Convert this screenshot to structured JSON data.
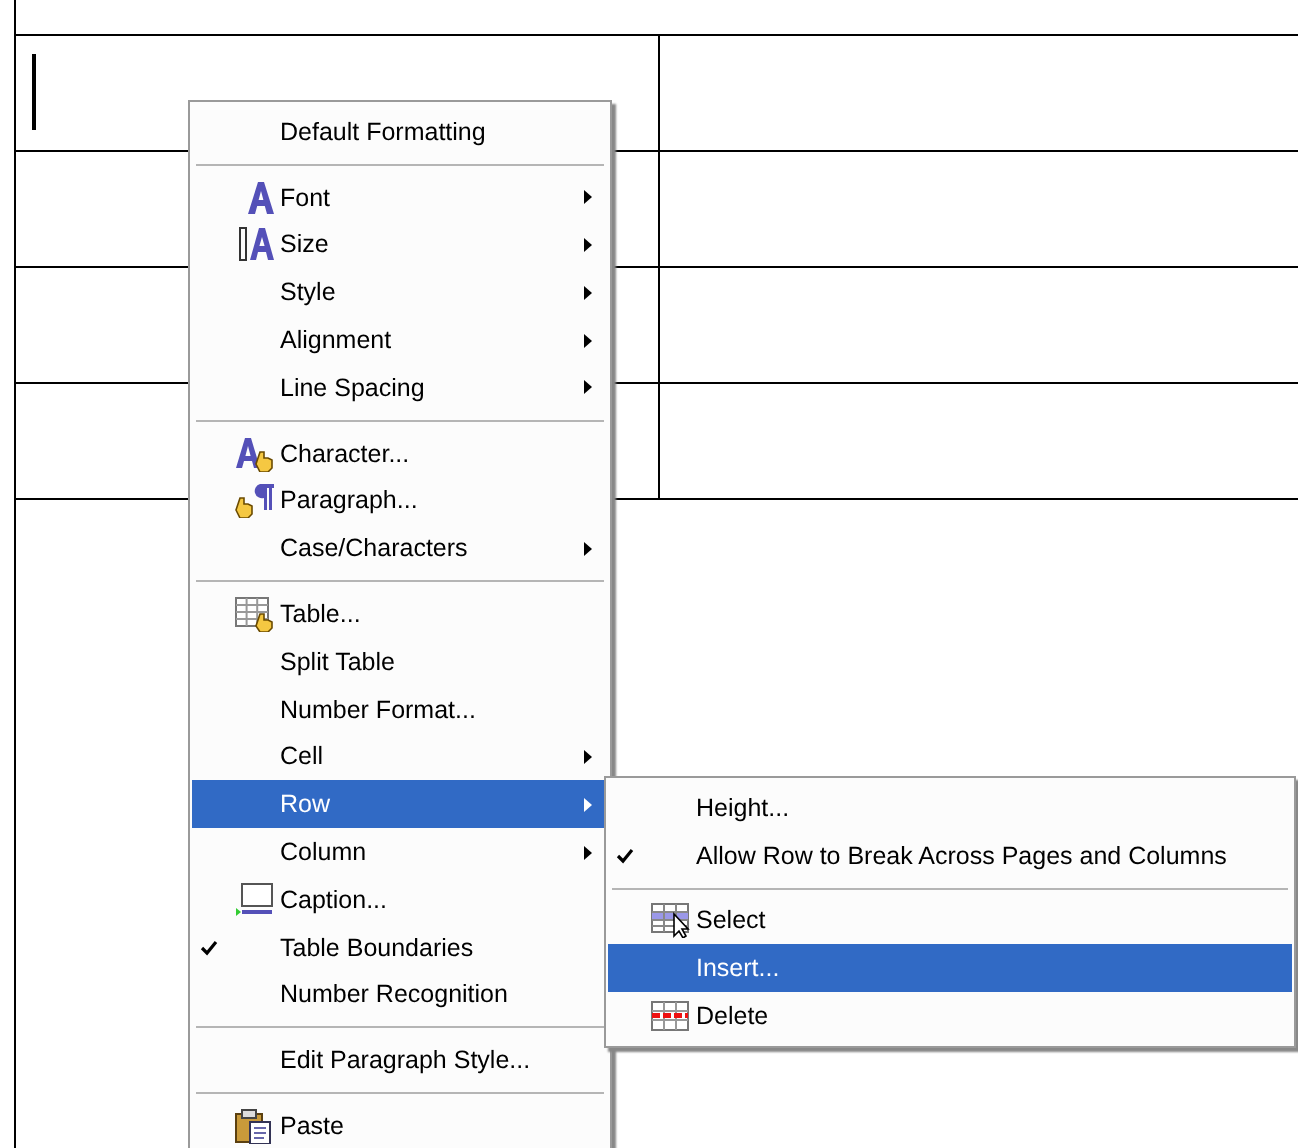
{
  "context_menu": {
    "items": [
      {
        "kind": "item",
        "label": "Default Formatting",
        "submenu": false,
        "checked": false,
        "selected": false
      },
      {
        "kind": "separator"
      },
      {
        "kind": "item",
        "label": "Font",
        "submenu": true,
        "checked": false,
        "selected": false
      },
      {
        "kind": "item",
        "label": "Size",
        "submenu": true,
        "checked": false,
        "selected": false
      },
      {
        "kind": "item",
        "label": "Style",
        "submenu": true,
        "checked": false,
        "selected": false
      },
      {
        "kind": "item",
        "label": "Alignment",
        "submenu": true,
        "checked": false,
        "selected": false
      },
      {
        "kind": "item",
        "label": "Line Spacing",
        "submenu": true,
        "checked": false,
        "selected": false
      },
      {
        "kind": "separator"
      },
      {
        "kind": "item",
        "label": "Character...",
        "submenu": false,
        "checked": false,
        "selected": false
      },
      {
        "kind": "item",
        "label": "Paragraph...",
        "submenu": false,
        "checked": false,
        "selected": false
      },
      {
        "kind": "item",
        "label": "Case/Characters",
        "submenu": true,
        "checked": false,
        "selected": false
      },
      {
        "kind": "separator"
      },
      {
        "kind": "item",
        "label": "Table...",
        "submenu": false,
        "checked": false,
        "selected": false
      },
      {
        "kind": "item",
        "label": "Split Table",
        "submenu": false,
        "checked": false,
        "selected": false
      },
      {
        "kind": "item",
        "label": "Number Format...",
        "submenu": false,
        "checked": false,
        "selected": false
      },
      {
        "kind": "item",
        "label": "Cell",
        "submenu": true,
        "checked": false,
        "selected": false
      },
      {
        "kind": "item",
        "label": "Row",
        "submenu": true,
        "checked": false,
        "selected": true
      },
      {
        "kind": "item",
        "label": "Column",
        "submenu": true,
        "checked": false,
        "selected": false
      },
      {
        "kind": "item",
        "label": "Caption...",
        "submenu": false,
        "checked": false,
        "selected": false
      },
      {
        "kind": "item",
        "label": "Table Boundaries",
        "submenu": false,
        "checked": true,
        "selected": false
      },
      {
        "kind": "item",
        "label": "Number Recognition",
        "submenu": false,
        "checked": false,
        "selected": false
      },
      {
        "kind": "separator"
      },
      {
        "kind": "item",
        "label": "Edit Paragraph Style...",
        "submenu": false,
        "checked": false,
        "selected": false
      },
      {
        "kind": "separator"
      },
      {
        "kind": "item",
        "label": "Paste",
        "submenu": false,
        "checked": false,
        "selected": false
      }
    ]
  },
  "row_submenu": {
    "items": [
      {
        "kind": "item",
        "label": "Height...",
        "submenu": false,
        "checked": false,
        "selected": false
      },
      {
        "kind": "item",
        "label": "Allow Row to Break Across Pages and Columns",
        "submenu": false,
        "checked": true,
        "selected": false
      },
      {
        "kind": "separator"
      },
      {
        "kind": "item",
        "label": "Select",
        "submenu": false,
        "checked": false,
        "selected": false
      },
      {
        "kind": "item",
        "label": "Insert...",
        "submenu": false,
        "checked": false,
        "selected": true
      },
      {
        "kind": "item",
        "label": "Delete",
        "submenu": false,
        "checked": false,
        "selected": false
      }
    ]
  }
}
